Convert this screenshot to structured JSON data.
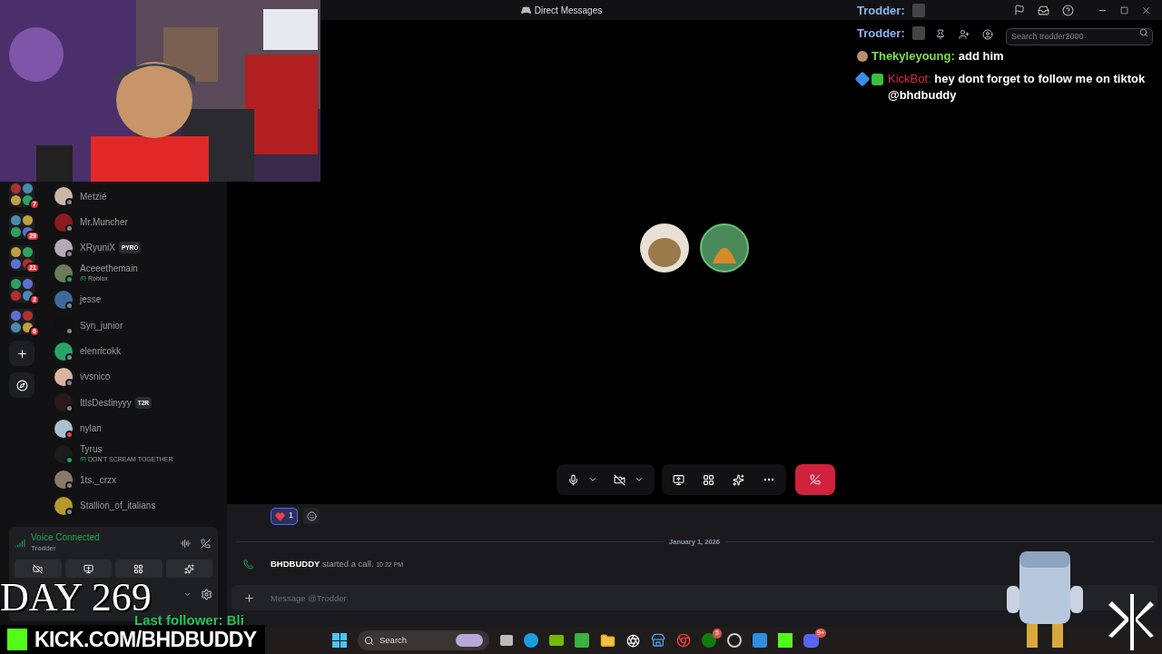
{
  "title_bar": {
    "title": "Direct Messages"
  },
  "header": {
    "search_placeholder": "Search trodder2000"
  },
  "stream_chat": [
    {
      "kind": "emote",
      "user": "Trodder:",
      "color": "#8fb4ef"
    },
    {
      "kind": "emote",
      "user": "Trodder:",
      "color": "#8fb4ef"
    },
    {
      "kind": "viewer",
      "user": "Thekyleyoung:",
      "color": "#7ee04a",
      "text": "add him"
    },
    {
      "kind": "bot",
      "user": "KickBot:",
      "color": "#d9264e",
      "text": "hey dont forget to follow me on tiktok @bhdbuddy"
    }
  ],
  "servers": [
    {
      "badge": "7"
    },
    {
      "badge": "29"
    },
    {
      "badge": "21"
    },
    {
      "badge": "2"
    },
    {
      "badge": "6"
    }
  ],
  "direct_messages": [
    {
      "name": "Metzié",
      "color": "#80848e"
    },
    {
      "name": "Mr.Muncher",
      "color": "#80848e"
    },
    {
      "name": "XRyuniX",
      "color": "#80848e",
      "tag": "PYRO"
    },
    {
      "name": "Aceeethemain",
      "color": "#23a55a",
      "activity": "Roblox"
    },
    {
      "name": "jesse",
      "color": "#80848e"
    },
    {
      "name": "Syn_junior",
      "color": "#80848e"
    },
    {
      "name": "elenricokk",
      "color": "#80848e"
    },
    {
      "name": "vvsnico",
      "color": "#80848e"
    },
    {
      "name": "ItIsDestinyyy",
      "color": "#80848e",
      "tag": "T2R"
    },
    {
      "name": "nylan",
      "color": "#f23f43"
    },
    {
      "name": "Tyrus",
      "color": "#23a55a",
      "activity": "DON'T SCREAM TOGETHER"
    },
    {
      "name": "1ts._crzx",
      "color": "#80848e"
    },
    {
      "name": "Stallion_of_italians",
      "color": "#80848e"
    }
  ],
  "voice_panel": {
    "status": "Voice Connected",
    "channel": "Trodder"
  },
  "reaction": {
    "count": "1",
    "selected": true
  },
  "date_divider": "January 1, 2026",
  "call_event": {
    "user": "BHDBUDDY",
    "text": "started a call.",
    "time": "10:22 PM"
  },
  "composer": {
    "placeholder": "Message @Trodder"
  },
  "overlay": {
    "day": "DAY 269",
    "last_follower": "Last follower: Bli",
    "url": "KICK.COM/BHDBUDDY"
  },
  "taskbar": {
    "search": "Search",
    "xbox_badge": "5",
    "discord_badge": "9+"
  }
}
